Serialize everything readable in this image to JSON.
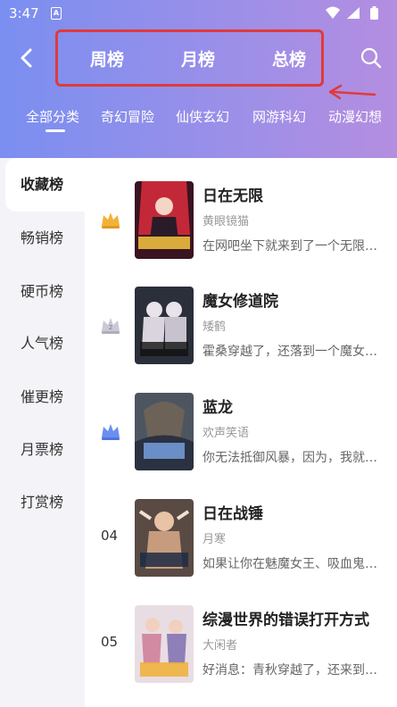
{
  "status_bar": {
    "time": "3:47",
    "notification_icon_letter": "A",
    "icons": [
      "wifi-icon",
      "signal-icon",
      "battery-icon"
    ]
  },
  "header": {
    "tabs": [
      {
        "label": "周榜"
      },
      {
        "label": "月榜"
      },
      {
        "label": "总榜"
      }
    ],
    "icons": [
      "back-arrow-icon",
      "search-icon"
    ],
    "highlight_color": "#e03a3a"
  },
  "categories": [
    {
      "label": "全部分类",
      "selected": true
    },
    {
      "label": "奇幻冒险"
    },
    {
      "label": "仙侠玄幻"
    },
    {
      "label": "网游科幻"
    },
    {
      "label": "动漫幻想"
    }
  ],
  "sidebar": {
    "items": [
      {
        "label": "收藏榜",
        "selected": true
      },
      {
        "label": "畅销榜"
      },
      {
        "label": "硬币榜"
      },
      {
        "label": "人气榜"
      },
      {
        "label": "催更榜"
      },
      {
        "label": "月票榜"
      },
      {
        "label": "打赏榜"
      }
    ]
  },
  "books": [
    {
      "rank": "1",
      "rank_badge": "gold-crown-icon",
      "title": "日在无限",
      "author": "黄眼镜猫",
      "desc": "在网吧坐下就来到了一个无限世界…"
    },
    {
      "rank": "2",
      "rank_badge": "silver-crown-icon",
      "title": "魔女修道院",
      "author": "矮鹤",
      "desc": "霍桑穿越了，还落到一个魔女修道院…"
    },
    {
      "rank": "3",
      "rank_badge": "blue-crown-icon",
      "title": "蓝龙",
      "author": "欢声笑语",
      "desc": "你无法抵御风暴，因为，我就是风暴…"
    },
    {
      "rank": "04",
      "title": "日在战锤",
      "author": "月寒",
      "desc": "如果让你在魅魔女王、吸血鬼女王…"
    },
    {
      "rank": "05",
      "title": "综漫世界的错误打开方式",
      "author": "大闲者",
      "desc": "好消息：青秋穿越了，还来到了综漫…"
    }
  ],
  "colors": {
    "gold": "#f2b23a",
    "silver": "#c9c9d6",
    "blue": "#6b8ff0",
    "accent": "#8a8fe8"
  }
}
